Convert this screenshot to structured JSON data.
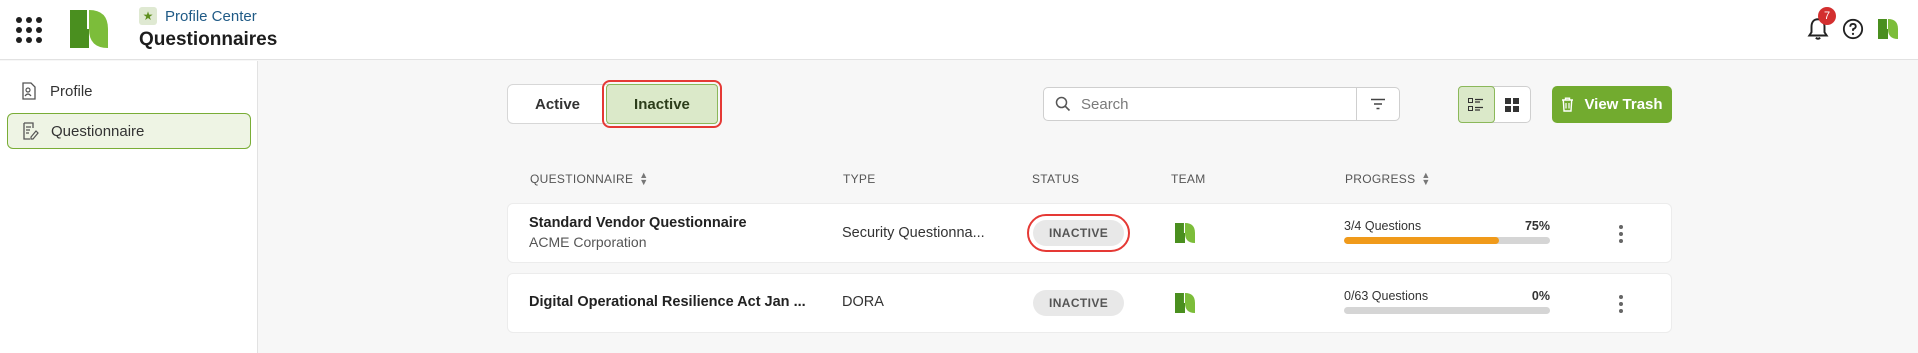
{
  "header": {
    "breadcrumb": "Profile Center",
    "title": "Questionnaires",
    "notification_count": "7"
  },
  "sidebar": {
    "items": [
      {
        "label": "Profile",
        "icon": "profile-doc-icon"
      },
      {
        "label": "Questionnaire",
        "icon": "questionnaire-edit-icon",
        "active": true
      }
    ]
  },
  "tabs": {
    "active_label": "Active",
    "inactive_label": "Inactive"
  },
  "search": {
    "placeholder": "Search",
    "value": ""
  },
  "toolbar": {
    "trash_label": "View Trash"
  },
  "table": {
    "headers": {
      "questionnaire": "QUESTIONNAIRE",
      "type": "TYPE",
      "status": "STATUS",
      "team": "TEAM",
      "progress": "PROGRESS"
    },
    "rows": [
      {
        "title": "Standard Vendor Questionnaire",
        "subtitle": "ACME Corporation",
        "type": "Security Questionna...",
        "status": "INACTIVE",
        "progress_text": "3/4 Questions",
        "progress_pct": "75%",
        "progress_value": 0.75
      },
      {
        "title": "Digital Operational Resilience Act Jan ...",
        "subtitle": "",
        "type": "DORA",
        "status": "INACTIVE",
        "progress_text": "0/63 Questions",
        "progress_pct": "0%",
        "progress_value": 0
      }
    ]
  },
  "colors": {
    "brand_green": "#72ab2f",
    "progress_orange": "#f09a1a",
    "highlight_red": "#e53935",
    "badge_red": "#d32f2f"
  }
}
